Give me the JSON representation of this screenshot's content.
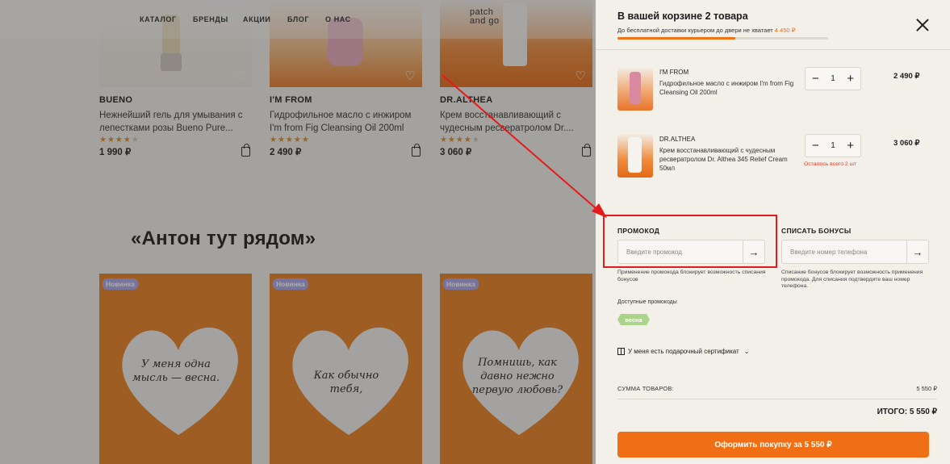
{
  "nav": {
    "items": [
      "КАТАЛОГ",
      "БРЕНДЫ",
      "АКЦИИ",
      "БЛОГ",
      "О НАС"
    ],
    "logo": [
      "patch",
      "and go"
    ]
  },
  "products": [
    {
      "brand": "BUENO",
      "name": "Нежнейший гель для умывания с лепестками розы Bueno Pure...",
      "rating": 4,
      "price": "1 990 ₽"
    },
    {
      "brand": "I'M FROM",
      "name": "Гидрофильное масло с инжиром I'm from Fig Cleansing Oil 200ml",
      "rating": 5,
      "price": "2 490 ₽"
    },
    {
      "brand": "DR.ALTHEA",
      "name": "Крем восстанавливающий с чудесным ресвератролом Dr....",
      "rating": 4,
      "price": "3 060 ₽"
    }
  ],
  "section": {
    "title": "«Антон тут рядом»",
    "cards": [
      {
        "badge": "Новинка",
        "note": "У меня одна мысль — весна."
      },
      {
        "badge": "Новинка",
        "note": "Как обычно тебя,"
      },
      {
        "badge": "Новинка",
        "note": "Помнишь, как давно нежно первую любовь?"
      }
    ]
  },
  "cart": {
    "title": "В вашей корзине 2 товара",
    "shipping_text": "До бесплатной доставки курьером до двери не хватает",
    "shipping_rest": "4 450 ₽",
    "shipping_progress": 0.56,
    "items": [
      {
        "brand": "I'M FROM",
        "desc": "Гидрофильное масло с инжиром I'm from Fig Cleansing Oil 200ml",
        "qty": "1",
        "price": "2 490 ₽",
        "warning": ""
      },
      {
        "brand": "DR.ALTHEA",
        "desc": "Крем восстанавливающий с чудесным ресвератролом Dr. Althea 345 Relief Cream 50мл",
        "qty": "1",
        "price": "3 060 ₽",
        "warning": "Осталось всего 2 шт"
      }
    ],
    "stepper": {
      "minus": "−",
      "plus": "+"
    },
    "promo": {
      "label": "ПРОМОКОД",
      "placeholder": "Введите промокод",
      "hint": "Применение промокода блокирует возможность списания бонусов"
    },
    "bonus": {
      "label": "СПИСАТЬ БОНУСЫ",
      "placeholder": "Введите номер телефона",
      "hint": "Списание бонусов блокирует возможность применения промокода. Для списания подтвердите ваш номер телефона."
    },
    "available_label": "Доступные промокоды",
    "available_codes": [
      "весна"
    ],
    "gift_label": "У меня есть подарочный сертификат",
    "sum_label": "СУММА ТОВАРОВ:",
    "sum_value": "5 550 ₽",
    "total": "ИТОГО: 5 550 ₽",
    "checkout": "Оформить покупку за 5 550 ₽"
  },
  "colors": {
    "accent": "#f16f14",
    "annotation": "#e51a1a",
    "promo_chip": "#a9d48a"
  }
}
